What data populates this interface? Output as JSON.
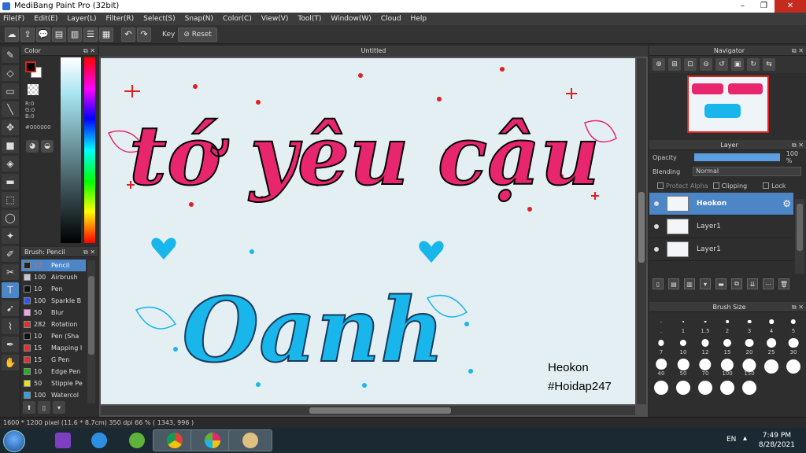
{
  "app": {
    "title": "MediBang Paint Pro (32bit)"
  },
  "menu": [
    "File(F)",
    "Edit(E)",
    "Layer(L)",
    "Filter(R)",
    "Select(S)",
    "Snap(N)",
    "Color(C)",
    "View(V)",
    "Tool(T)",
    "Window(W)",
    "Cloud",
    "Help"
  ],
  "toolbar": {
    "key_label": "Key",
    "reset_label": "Reset"
  },
  "color_panel": {
    "title": "Color",
    "r": "R:0",
    "g": "G:0",
    "b": "B:0",
    "hex": "#000000",
    "foreground": "#000000",
    "background": "#ffffff"
  },
  "brush_panel": {
    "title": "Brush: Pencil",
    "items": [
      {
        "size": "12",
        "name": "Pencil",
        "color": "#222222"
      },
      {
        "size": "100",
        "name": "Airbrush",
        "color": "#c8c8c8"
      },
      {
        "size": "10",
        "name": "Pen",
        "color": "#111111"
      },
      {
        "size": "100",
        "name": "Sparkle B",
        "color": "#3355ee"
      },
      {
        "size": "50",
        "name": "Blur",
        "color": "#f0a0f0"
      },
      {
        "size": "282",
        "name": "Rotation",
        "color": "#e03030"
      },
      {
        "size": "10",
        "name": "Pen (Sha",
        "color": "#111111"
      },
      {
        "size": "15",
        "name": "Mapping I",
        "color": "#e03030"
      },
      {
        "size": "15",
        "name": "G Pen",
        "color": "#e03030"
      },
      {
        "size": "10",
        "name": "Edge Pen",
        "color": "#20b020"
      },
      {
        "size": "50",
        "name": "Stipple Pe",
        "color": "#e8e020"
      },
      {
        "size": "100",
        "name": "Watercol",
        "color": "#30a0e0"
      }
    ]
  },
  "document": {
    "tab": "Untitled",
    "line1": "tớ yêu cậu",
    "line2": "Oanh",
    "signature1": "Heokon",
    "signature2": "#Hoidap247",
    "colors": {
      "pink": "#e8266e",
      "blue": "#19b6ec",
      "bg": "#e4eff3"
    }
  },
  "navigator": {
    "title": "Navigator"
  },
  "layer_panel": {
    "title": "Layer",
    "opacity_label": "Opacity",
    "opacity_value": "100 %",
    "opacity_fraction": 1.0,
    "blending_label": "Blending",
    "blending_value": "Normal",
    "protect_alpha": "Protect Alpha",
    "clipping": "Clipping",
    "lock": "Lock",
    "layers": [
      {
        "name": "Heokon",
        "selected": true
      },
      {
        "name": "Layer1",
        "selected": false
      },
      {
        "name": "Layer1",
        "selected": false
      }
    ]
  },
  "brush_size": {
    "title": "Brush Size",
    "sizes": [
      ".",
      "1",
      "1.5",
      "2",
      "3",
      "4",
      "5",
      "7",
      "10",
      "12",
      "15",
      "20",
      "25",
      "30",
      "40",
      "50",
      "70",
      "100",
      "150",
      "",
      "",
      "",
      "",
      "",
      "",
      ""
    ]
  },
  "status": {
    "text": "1600 * 1200 pixel   (11.6 * 8.7cm)   350 dpi   66 %   ( 1343, 996 )"
  },
  "taskbar": {
    "lang": "EN",
    "time": "7:49 PM",
    "date": "8/28/2021"
  }
}
